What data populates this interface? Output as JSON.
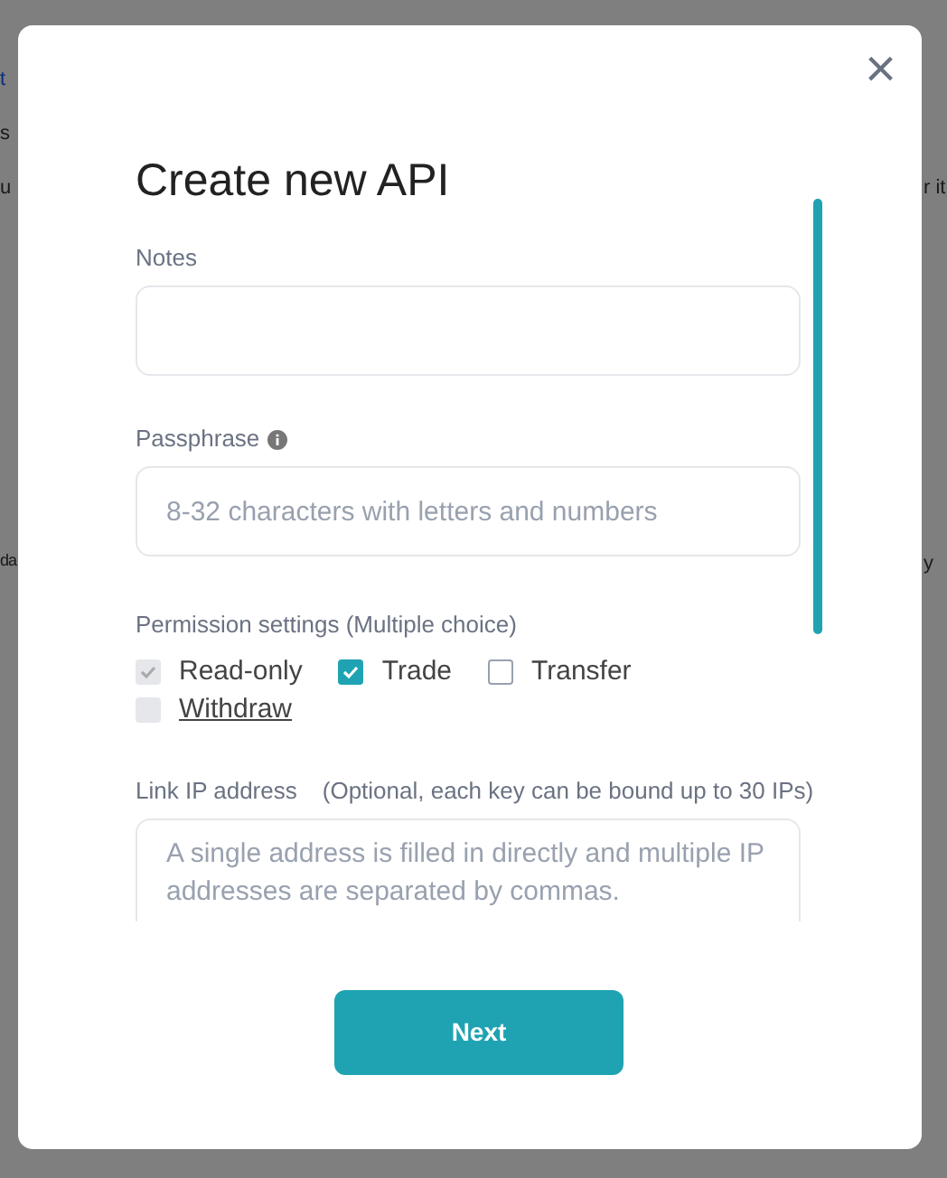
{
  "background_fragments": [
    {
      "text": "t"
    },
    {
      "text": "s"
    },
    {
      "text": "u"
    },
    {
      "text": "r it"
    },
    {
      "text": "da"
    },
    {
      "text": "y"
    }
  ],
  "dialog": {
    "title": "Create new API",
    "close_icon": "×",
    "notes": {
      "label": "Notes"
    },
    "passphrase": {
      "label": "Passphrase",
      "placeholder": "8-32 characters with letters and numbers"
    },
    "permissions": {
      "label": "Permission settings (Multiple choice)",
      "options": [
        {
          "label": "Read-only",
          "checked": true,
          "disabled": true,
          "underlined": false
        },
        {
          "label": "Trade",
          "checked": true,
          "disabled": false,
          "underlined": false
        },
        {
          "label": "Transfer",
          "checked": false,
          "disabled": false,
          "underlined": false
        },
        {
          "label": "Withdraw",
          "checked": false,
          "disabled": true,
          "underlined": true
        }
      ]
    },
    "ip": {
      "label": "Link IP address",
      "hint": "(Optional, each key can be bound up to 30 IPs)",
      "placeholder": "A single address is filled in directly and multiple IP addresses are separated by commas."
    },
    "next_button": "Next"
  }
}
